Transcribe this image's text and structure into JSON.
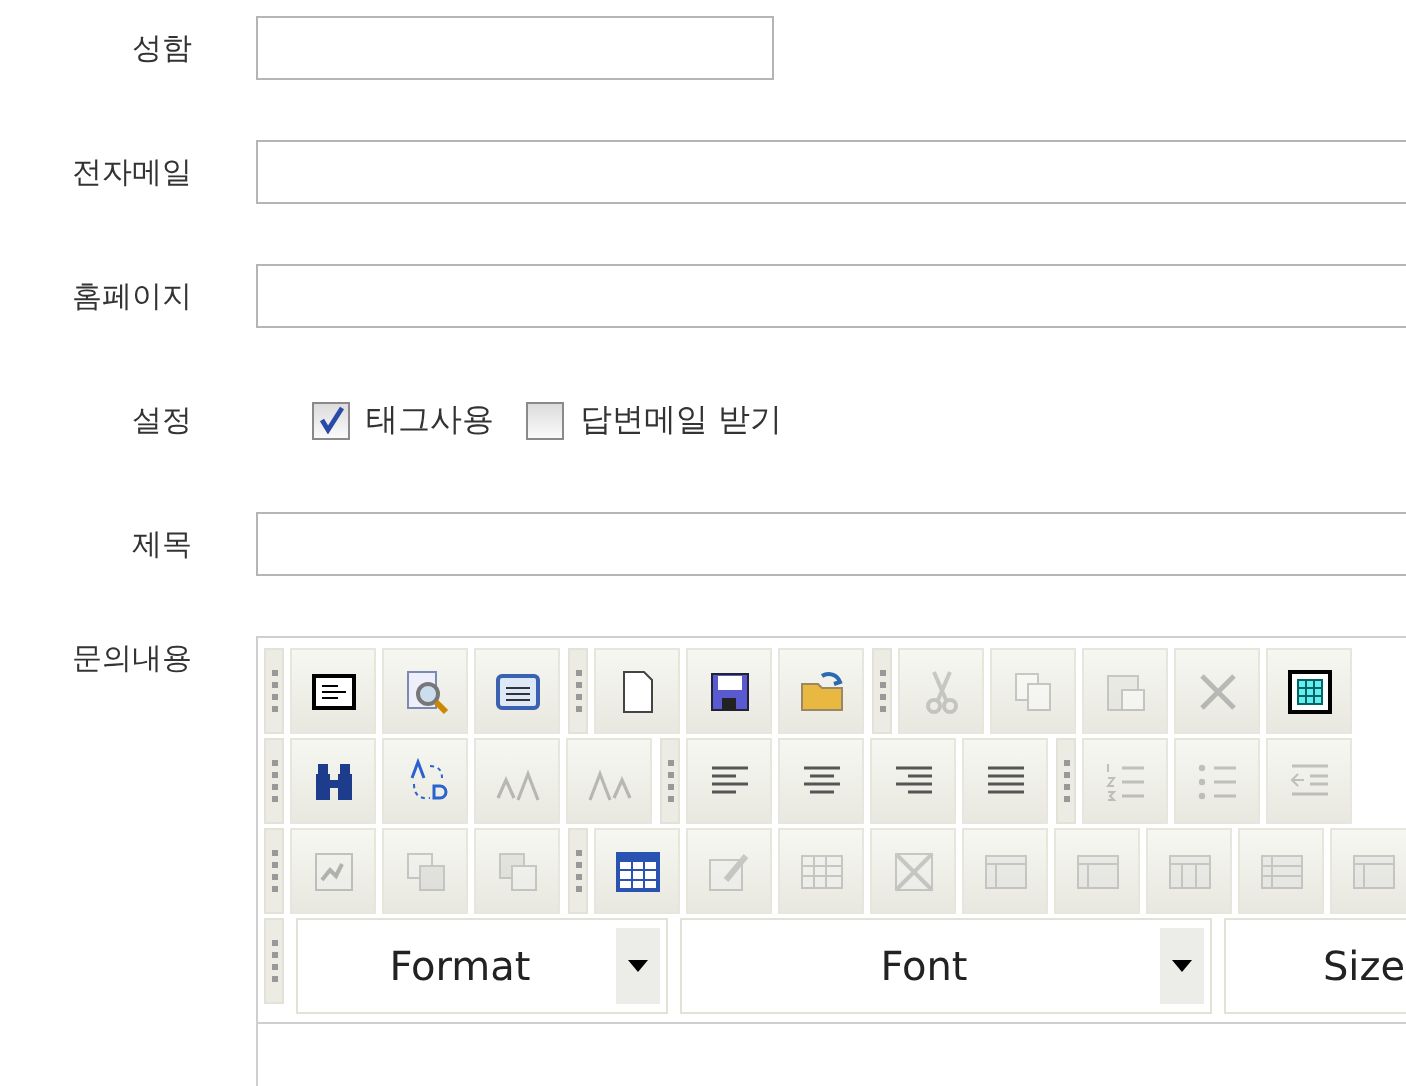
{
  "fields": [
    {
      "label": "성함",
      "kind": "short"
    },
    {
      "label": "전자메일",
      "kind": "long"
    },
    {
      "label": "홈페이지",
      "kind": "long"
    }
  ],
  "settings": {
    "label": "설정",
    "options": [
      {
        "label": "태그사용",
        "checked": true
      },
      {
        "label": "답변메일 받기",
        "checked": false
      }
    ]
  },
  "subject": {
    "label": "제목"
  },
  "editor": {
    "label": "문의내용",
    "toolbar_rows": [
      [
        [
          {
            "disabled": false
          },
          {
            "disabled": false
          },
          {
            "disabled": false
          }
        ],
        [
          {
            "disabled": false
          },
          {
            "disabled": false
          },
          {
            "disabled": false
          }
        ],
        [
          {
            "disabled": true
          },
          {
            "disabled": true
          },
          {
            "disabled": true
          },
          {
            "disabled": true
          },
          {
            "disabled": false
          }
        ]
      ],
      [
        [
          {
            "disabled": false
          },
          {
            "disabled": false
          },
          {
            "disabled": true
          },
          {
            "disabled": true
          }
        ],
        [
          {
            "disabled": false
          },
          {
            "disabled": false
          },
          {
            "disabled": false
          },
          {
            "disabled": false
          }
        ],
        [
          {
            "disabled": true
          },
          {
            "disabled": true
          },
          {
            "disabled": true
          }
        ]
      ],
      [
        [
          {
            "disabled": true
          },
          {
            "disabled": true
          },
          {
            "disabled": true
          }
        ],
        [
          {
            "disabled": false
          },
          {
            "disabled": true
          },
          {
            "disabled": true
          },
          {
            "disabled": true
          },
          {
            "disabled": true
          },
          {
            "disabled": true
          },
          {
            "disabled": true
          },
          {
            "disabled": true
          },
          {
            "disabled": true
          }
        ]
      ]
    ],
    "combos": [
      {
        "value": "Format"
      },
      {
        "value": "Font"
      },
      {
        "value": "Size"
      }
    ]
  }
}
